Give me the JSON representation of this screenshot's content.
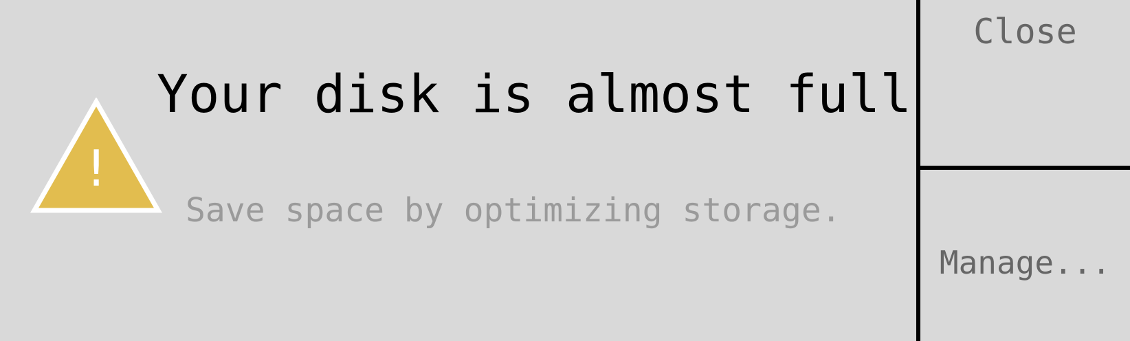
{
  "notification": {
    "title": "Your disk is almost full",
    "message": "Save space by optimizing storage.",
    "icon": "warning-icon",
    "icon_symbol": "!",
    "colors": {
      "background": "#d9d9d9",
      "warning": "#e2bd4f",
      "title": "#000000",
      "message": "#9a9a9a",
      "button_text": "#666666",
      "divider": "#000000"
    }
  },
  "actions": {
    "close_label": "Close",
    "manage_label": "Manage..."
  }
}
